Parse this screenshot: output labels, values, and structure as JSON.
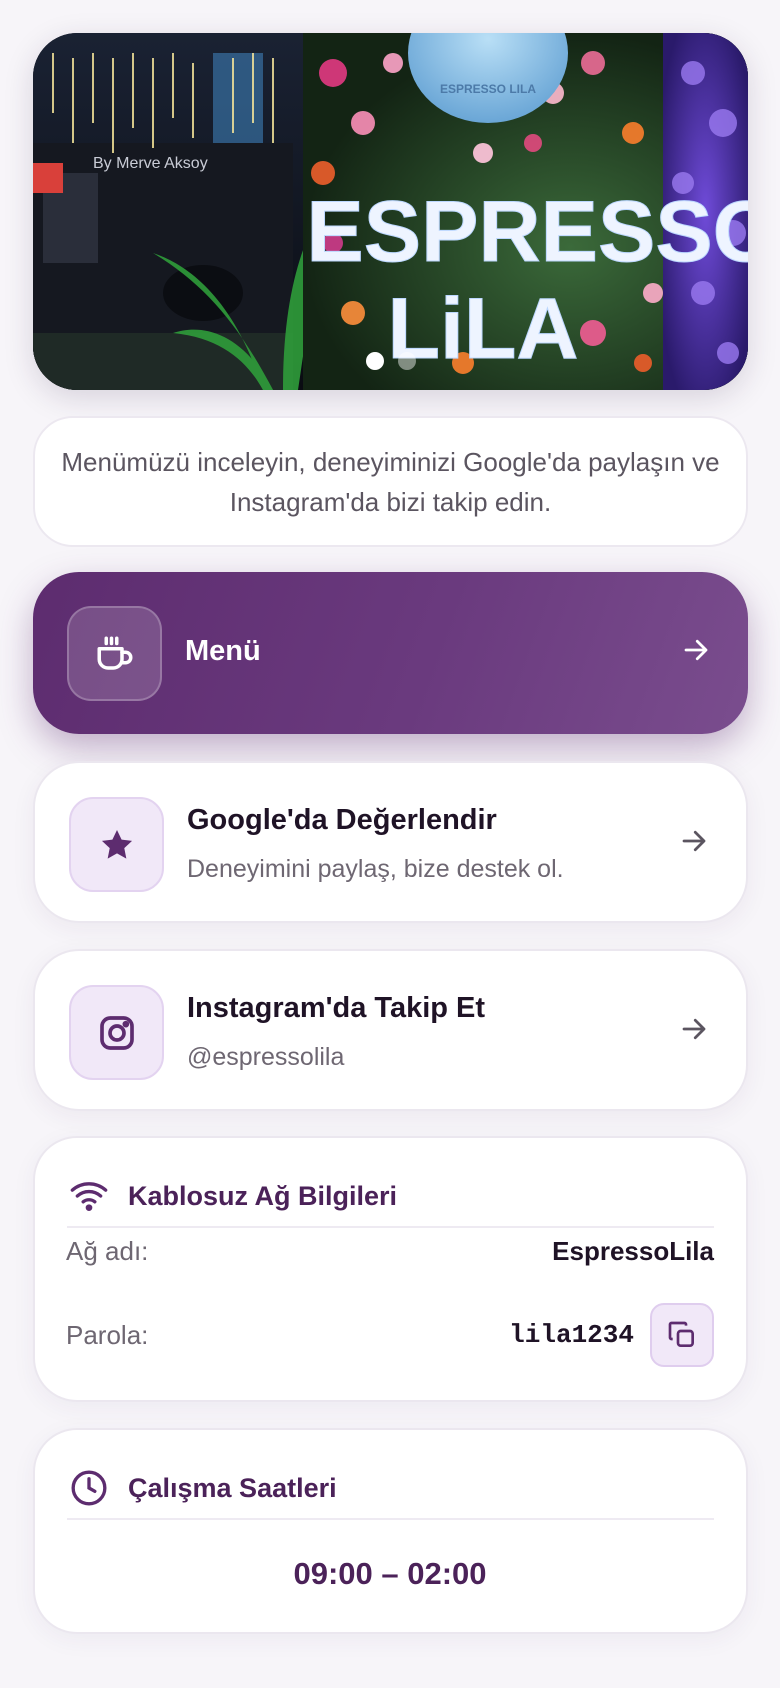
{
  "hero": {
    "sign_text_line1": "ESPRESSO",
    "sign_text_line2": "LiLA",
    "badge_text": "ESPRESSO LILA",
    "shop_text": "By Merve Aksoy",
    "slides": 2,
    "active_slide": 1
  },
  "intro": {
    "text": "Menümüzü inceleyin, deneyiminizi Google'da paylaşın ve Instagram'da bizi takip edin."
  },
  "actions": {
    "menu": {
      "title": "Menü",
      "icon": "coffee-cup-icon"
    },
    "google": {
      "title": "Google'da Değerlendir",
      "subtitle": "Deneyimini paylaş, bize destek ol.",
      "icon": "star-icon"
    },
    "instagram": {
      "title": "Instagram'da Takip Et",
      "subtitle": "@espressolila",
      "icon": "instagram-icon"
    }
  },
  "wifi": {
    "title": "Kablosuz Ağ Bilgileri",
    "network_label": "Ağ adı:",
    "network_value": "EspressoLila",
    "password_label": "Parola:",
    "password_value": "lila1234"
  },
  "hours": {
    "title": "Çalışma Saatleri",
    "value": "09:00 – 02:00"
  },
  "colors": {
    "brand": "#5d2c6f",
    "accent_light": "#f1e8f8",
    "title_purple": "#4b2259"
  }
}
